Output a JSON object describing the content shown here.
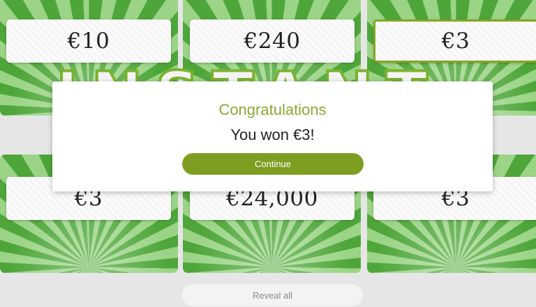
{
  "game": {
    "prizes": [
      "€10",
      "€240",
      "€3",
      "€3",
      "€24,000",
      "€3"
    ],
    "winning_prize_flags": [
      false,
      false,
      true,
      false,
      false,
      false
    ]
  },
  "dialog": {
    "title": "Congratulations",
    "message": "You won €3!",
    "continue_label": "Continue"
  },
  "footer": {
    "reveal_all_label": "Reveal all"
  },
  "colors": {
    "accent": "#7e9e22",
    "title": "#8aa833",
    "tile_dark": "#4ea63a",
    "tile_light": "#9bd486"
  }
}
